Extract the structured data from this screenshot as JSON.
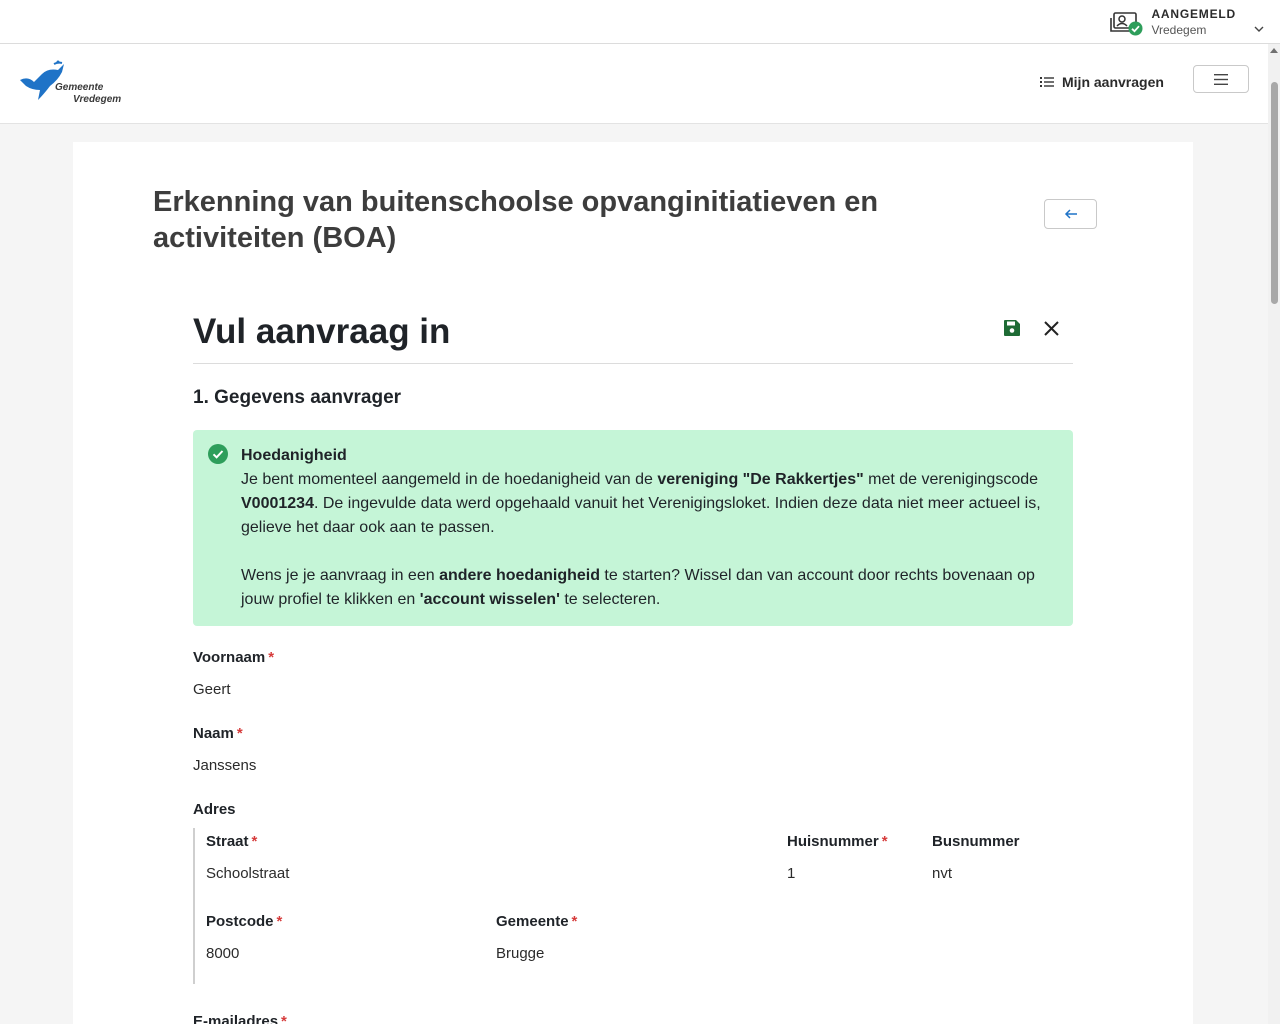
{
  "profile": {
    "status": "AANGEMELD",
    "municipality": "Vredegem"
  },
  "header": {
    "logo_line1": "Gemeente",
    "logo_line2": "Vredegem",
    "my_requests": "Mijn aanvragen"
  },
  "page": {
    "title": "Erkenning van buitenschoolse opvanginitiatieven en activiteiten (BOA)"
  },
  "form": {
    "title": "Vul aanvraag in",
    "section_title": "1. Gegevens aanvrager",
    "alert": {
      "title": "Hoedanigheid",
      "p1_a": "Je bent momenteel aangemeld in de hoedanigheid van de ",
      "p1_b": "vereniging \"De Rakkertjes\"",
      "p1_c": " met de verenigingscode ",
      "p1_d": "V0001234",
      "p1_e": ". De ingevulde data werd opgehaald vanuit het Verenigingsloket. Indien deze data niet meer actueel is, gelieve het daar ook aan te passen.",
      "p2_a": "Wens je je aanvraag in een ",
      "p2_b": "andere hoedanigheid",
      "p2_c": " te starten? Wissel dan van account door rechts bovenaan op jouw profiel te klikken en ",
      "p2_d": "'account wisselen'",
      "p2_e": " te selecteren."
    },
    "fields": {
      "voornaam_label": "Voornaam",
      "voornaam_value": "Geert",
      "naam_label": "Naam",
      "naam_value": "Janssens",
      "adres_label": "Adres",
      "straat_label": "Straat",
      "straat_value": "Schoolstraat",
      "huisnummer_label": "Huisnummer",
      "huisnummer_value": "1",
      "busnummer_label": "Busnummer",
      "busnummer_value": "nvt",
      "postcode_label": "Postcode",
      "postcode_value": "8000",
      "gemeente_label": "Gemeente",
      "gemeente_value": "Brugge",
      "email_label": "E-mailadres"
    },
    "required_mark": "*"
  },
  "colors": {
    "success_bg": "#c5f5d7",
    "success_icon": "#2e9e5b",
    "brand_blue": "#1f73c7",
    "required": "#d63b3b"
  },
  "icons": {
    "profile": "profile-card-icon",
    "status": "check-badge-icon",
    "list": "list-icon",
    "menu": "hamburger-icon",
    "back": "arrow-left-icon",
    "save": "floppy-disk-icon",
    "close": "close-icon"
  }
}
